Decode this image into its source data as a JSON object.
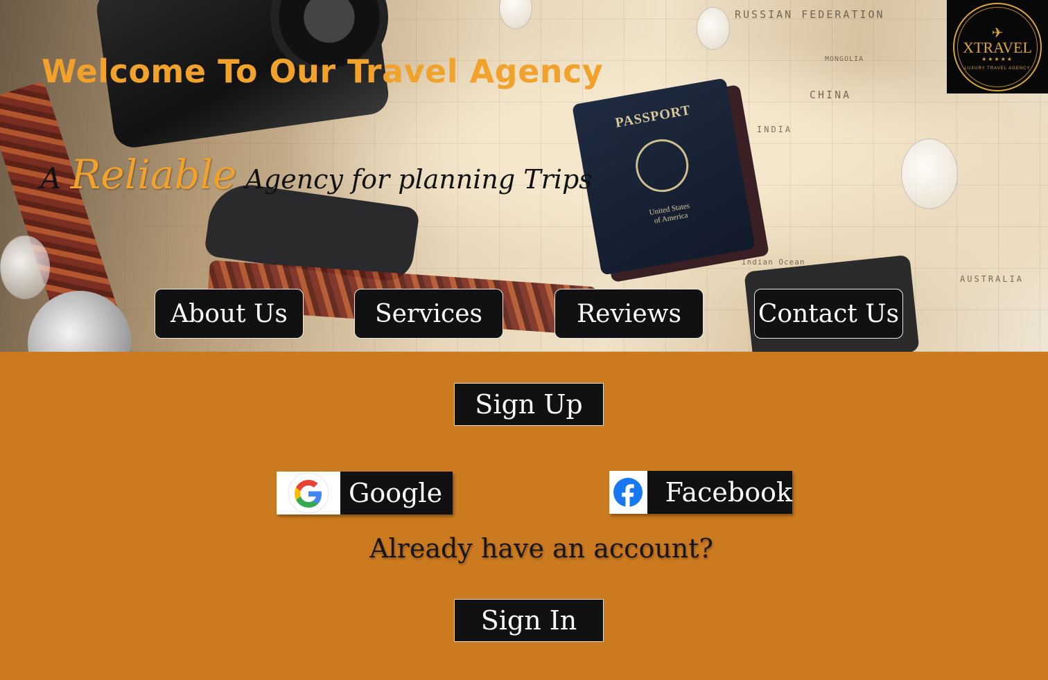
{
  "hero": {
    "title": "Welcome To Our Travel Agency",
    "tagline": {
      "prefix": "A ",
      "highlight": "Reliable",
      "rest": " Agency for planning Trips"
    },
    "map_labels": [
      "RUSSIAN FEDERATION",
      "CHINA",
      "INDIA",
      "AUSTRALIA",
      "MONGOLIA",
      "Indian Ocean"
    ],
    "passport": {
      "title": "PASSPORT",
      "country_line1": "United States",
      "country_line2": "of America"
    }
  },
  "logo": {
    "name": "XTRAVEL",
    "stars": "★★★★★",
    "tagline": "LUXURY TRAVEL AGENCY",
    "icon": "airplane-icon",
    "accent_color": "#d8a640"
  },
  "nav": {
    "items": [
      {
        "label": "About Us"
      },
      {
        "label": "Services"
      },
      {
        "label": "Reviews"
      },
      {
        "label": "Contact Us"
      }
    ]
  },
  "auth": {
    "signup_label": "Sign Up",
    "google_label": "Google",
    "facebook_label": "Facebook",
    "already_text": "Already have an account?",
    "signin_label": "Sign In"
  },
  "colors": {
    "accent": "#f0a22c",
    "section_bg": "#cc7a20",
    "button_bg": "#111111",
    "facebook_blue": "#1877f2"
  }
}
